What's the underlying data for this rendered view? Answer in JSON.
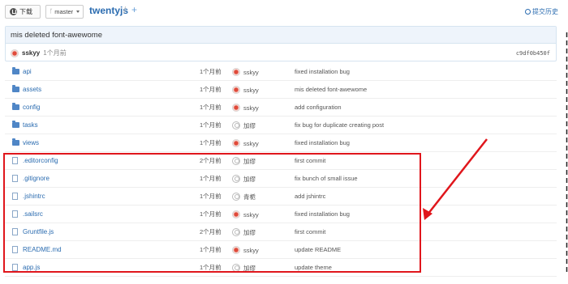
{
  "toolbar": {
    "download_label": "下载",
    "branch": "master",
    "repo_name": "twentyjs",
    "separator": "/",
    "add": "+",
    "history_label": "提交历史"
  },
  "commit": {
    "message": "mis deleted font-awewome",
    "author": "sskyy",
    "time": "1个月前",
    "sha": "c9df0b450f"
  },
  "files": [
    {
      "name": "api",
      "type": "folder",
      "time": "1个月前",
      "author": "sskyy",
      "avatar": "red",
      "message": "fixed installation bug"
    },
    {
      "name": "assets",
      "type": "folder",
      "time": "1个月前",
      "author": "sskyy",
      "avatar": "red",
      "message": "mis deleted font-awewome"
    },
    {
      "name": "config",
      "type": "folder",
      "time": "1个月前",
      "author": "sskyy",
      "avatar": "red",
      "message": "add configuration"
    },
    {
      "name": "tasks",
      "type": "folder",
      "time": "1个月前",
      "author": "加缪",
      "avatar": "gray",
      "message": "fix bug for duplicate creating post"
    },
    {
      "name": "views",
      "type": "folder",
      "time": "1个月前",
      "author": "sskyy",
      "avatar": "red",
      "message": "fixed installation bug"
    },
    {
      "name": ".editorconfig",
      "type": "file",
      "time": "2个月前",
      "author": "加缪",
      "avatar": "gray",
      "message": "first commit"
    },
    {
      "name": ".gitignore",
      "type": "file",
      "time": "1个月前",
      "author": "加缪",
      "avatar": "gray",
      "message": "fix bunch of small issue"
    },
    {
      "name": ".jshintrc",
      "type": "file",
      "time": "1个月前",
      "author": "青栀",
      "avatar": "gray",
      "message": "add jshintrc"
    },
    {
      "name": ".sailsrc",
      "type": "file",
      "time": "1个月前",
      "author": "sskyy",
      "avatar": "red",
      "message": "fixed installation bug"
    },
    {
      "name": "Gruntfile.js",
      "type": "file",
      "time": "2个月前",
      "author": "加缪",
      "avatar": "gray",
      "message": "first commit"
    },
    {
      "name": "README.md",
      "type": "file",
      "time": "1个月前",
      "author": "sskyy",
      "avatar": "red",
      "message": "update README"
    },
    {
      "name": "app.js",
      "type": "file",
      "time": "1个月前",
      "author": "加缪",
      "avatar": "gray",
      "message": "update theme"
    }
  ],
  "annotation": {
    "color": "#e0161c"
  }
}
